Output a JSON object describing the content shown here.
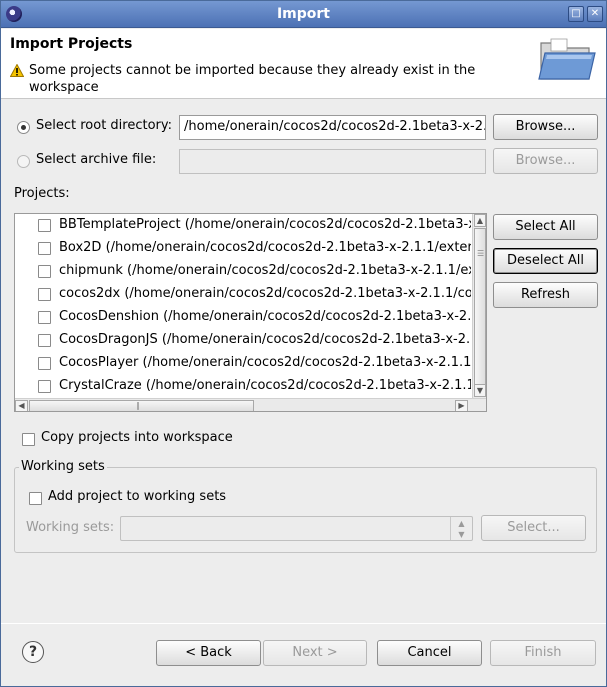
{
  "window": {
    "title": "Import"
  },
  "header": {
    "title": "Import Projects",
    "message": "Some projects cannot be imported because they already exist in the workspace"
  },
  "source": {
    "root_label": "Select root directory:",
    "root_value": "/home/onerain/cocos2d/cocos2d-2.1beta3-x-2.",
    "root_browse": "Browse...",
    "archive_label": "Select archive file:",
    "archive_value": "",
    "archive_browse": "Browse..."
  },
  "projects": {
    "label": "Projects:",
    "items": [
      "BBTemplateProject (/home/onerain/cocos2d/cocos2d-2.1beta3-x",
      "Box2D (/home/onerain/cocos2d/cocos2d-2.1beta3-x-2.1.1/exter",
      "chipmunk (/home/onerain/cocos2d/cocos2d-2.1beta3-x-2.1.1/ex",
      "cocos2dx (/home/onerain/cocos2d/cocos2d-2.1beta3-x-2.1.1/co",
      "CocosDenshion (/home/onerain/cocos2d/cocos2d-2.1beta3-x-2.",
      "CocosDragonJS (/home/onerain/cocos2d/cocos2d-2.1beta3-x-2.1",
      "CocosPlayer (/home/onerain/cocos2d/cocos2d-2.1beta3-x-2.1.1",
      "CrystalCraze (/home/onerain/cocos2d/cocos2d-2.1beta3-x-2.1.1"
    ],
    "select_all": "Select All",
    "deselect_all": "Deselect All",
    "refresh": "Refresh"
  },
  "options": {
    "copy_label": "Copy projects into workspace"
  },
  "working_sets": {
    "group_label": "Working sets",
    "add_label": "Add project to working sets",
    "sets_label": "Working sets:",
    "select_button": "Select..."
  },
  "footer": {
    "back": "< Back",
    "next": "Next >",
    "cancel": "Cancel",
    "finish": "Finish"
  }
}
